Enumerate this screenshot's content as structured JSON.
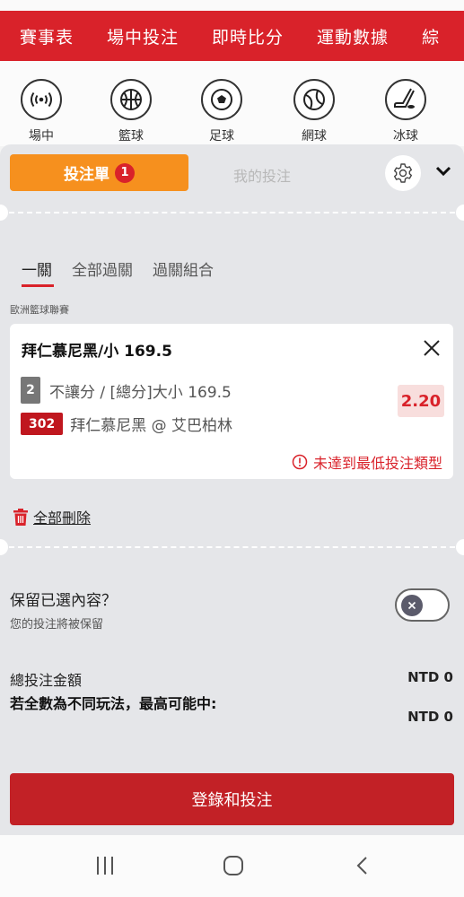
{
  "top_nav": [
    "賽事表",
    "場中投注",
    "即時比分",
    "運動數據",
    "綜"
  ],
  "sports": [
    {
      "label": "場中",
      "icon": "live-broadcast-icon"
    },
    {
      "label": "籃球",
      "icon": "basketball-icon"
    },
    {
      "label": "足球",
      "icon": "soccer-ball-icon"
    },
    {
      "label": "網球",
      "icon": "tennis-ball-icon"
    },
    {
      "label": "冰球",
      "icon": "ice-hockey-icon"
    }
  ],
  "betslip": {
    "tab_label": "投注單",
    "count": "1",
    "mybets_label": "我的投注"
  },
  "subtabs": [
    "一關",
    "全部過關",
    "過關組合"
  ],
  "league": "歐洲籃球聯賽",
  "bet": {
    "title": "拜仁慕尼黑/小 169.5",
    "market_number": "2",
    "market": "不讓分 / [總分]大小 169.5",
    "odds": "2.20",
    "match_id": "302",
    "match": "拜仁慕尼黑 @ 艾巴柏林",
    "warning": "未達到最低投注類型"
  },
  "delete_all": "全部刪除",
  "keep": {
    "title": "保留已選內容？",
    "subtitle": "您的投注將被保留"
  },
  "totals": {
    "total_label": "總投注金額",
    "total_value": "NTD 0",
    "maxwin_label": "若全數為不同玩法，最高可能中:",
    "maxwin_value": "NTD 0"
  },
  "login_bet_label": "登錄和投注",
  "colors": {
    "brand_red": "#d9222a",
    "orange": "#f6901e",
    "dark_red": "#c22126"
  }
}
